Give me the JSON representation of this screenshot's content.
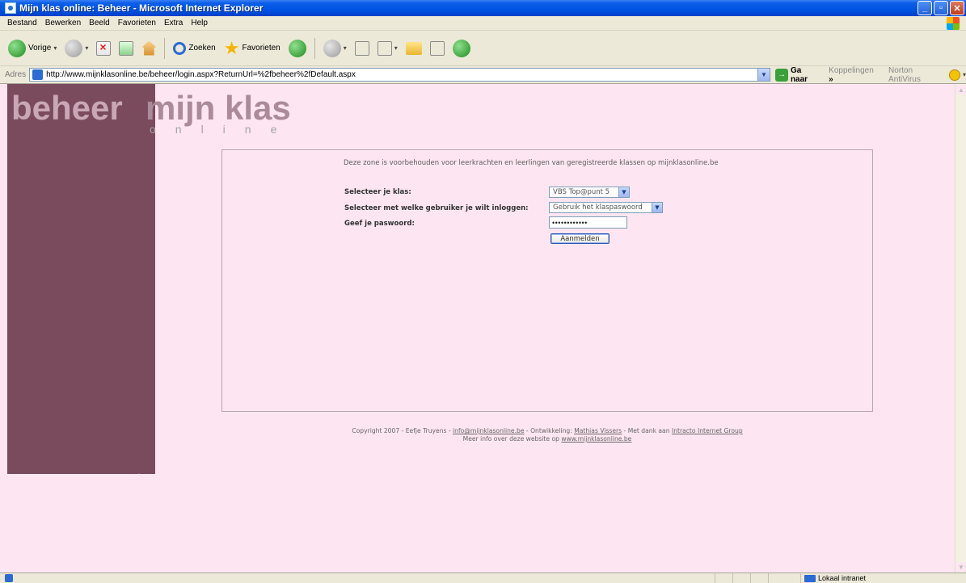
{
  "window": {
    "title": "Mijn klas online: Beheer - Microsoft Internet Explorer"
  },
  "menu": [
    "Bestand",
    "Bewerken",
    "Beeld",
    "Favorieten",
    "Extra",
    "Help"
  ],
  "toolbar": {
    "back_label": "Vorige",
    "search_label": "Zoeken",
    "favorites_label": "Favorieten"
  },
  "address": {
    "label": "Adres",
    "url": "http://www.mijnklasonline.be/beheer/login.aspx?ReturnUrl=%2fbeheer%2fDefault.aspx",
    "go_label": "Ga naar",
    "links_label": "Koppelingen",
    "more": "»",
    "norton_label": "Norton AntiVirus"
  },
  "logo": {
    "beheer": "beheer",
    "mijnklas": "mijn klas",
    "online": "online"
  },
  "form": {
    "intro": "Deze zone is voorbehouden voor leerkrachten en leerlingen van geregistreerde klassen op mijnklasonline.be",
    "class_label": "Selecteer je klas:",
    "class_value": "VBS Top@punt 5",
    "user_label": "Selecteer met welke gebruiker je wilt inloggen:",
    "user_value": "Gebruik het klaspaswoord",
    "password_label": "Geef je paswoord:",
    "password_value": "••••••••••••",
    "login_button": "Aanmelden"
  },
  "footer": {
    "copyright": "Copyright 2007 - Eefje Truyens - ",
    "email": "info@mijnklasonline.be",
    "dev_prefix": " - Ontwikkeling: ",
    "developer": "Mathias Vissers",
    "thanks_prefix": " - Met dank aan ",
    "thanks": "Intracto Internet Group",
    "more_prefix": "Meer info over deze website op ",
    "website": "www.mijnklasonline.be"
  },
  "status": {
    "zone": "Lokaal intranet"
  }
}
